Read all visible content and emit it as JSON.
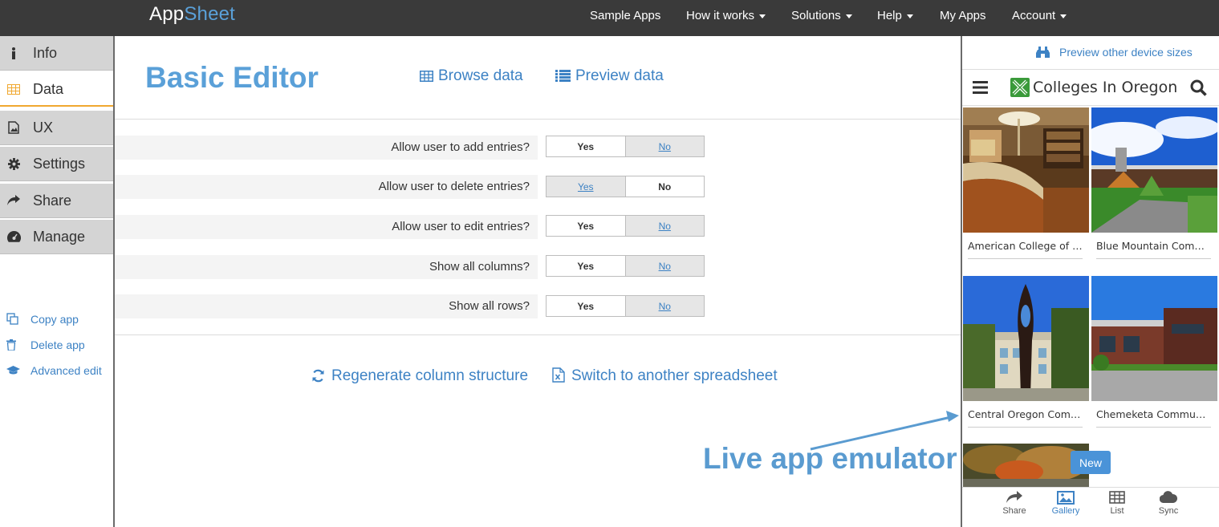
{
  "nav": {
    "brand_a": "App",
    "brand_b": "Sheet",
    "items": [
      "Sample Apps",
      "How it works",
      "Solutions",
      "Help",
      "My Apps",
      "Account"
    ]
  },
  "sidebar": {
    "items": [
      {
        "label": "Info",
        "icon": "info-icon"
      },
      {
        "label": "Data",
        "icon": "table-icon"
      },
      {
        "label": "UX",
        "icon": "image-file-icon"
      },
      {
        "label": "Settings",
        "icon": "gear-icon"
      },
      {
        "label": "Share",
        "icon": "share-arrow-icon"
      },
      {
        "label": "Manage",
        "icon": "dashboard-icon"
      }
    ],
    "links": [
      {
        "label": "Copy app",
        "icon": "copy-icon"
      },
      {
        "label": "Delete app",
        "icon": "trash-icon"
      },
      {
        "label": "Advanced edit",
        "icon": "graduation-cap-icon"
      }
    ]
  },
  "main": {
    "title": "Basic Editor",
    "browse_label": "Browse data",
    "preview_label": "Preview data",
    "options": [
      {
        "question": "Allow user to add entries?",
        "yes": "Yes",
        "no": "No",
        "selected": "no"
      },
      {
        "question": "Allow user to delete entries?",
        "yes": "Yes",
        "no": "No",
        "selected": "yes"
      },
      {
        "question": "Allow user to edit entries?",
        "yes": "Yes",
        "no": "No",
        "selected": "no"
      },
      {
        "question": "Show all columns?",
        "yes": "Yes",
        "no": "No",
        "selected": "no"
      },
      {
        "question": "Show all rows?",
        "yes": "Yes",
        "no": "No",
        "selected": "no"
      }
    ],
    "regenerate_label": "Regenerate column structure",
    "switch_label": "Switch to another spreadsheet",
    "annotation": "Live app emulator"
  },
  "emulator": {
    "preview_sizes": "Preview other device sizes",
    "app_title": "Colleges In Oregon",
    "tiles": [
      "American College of Healthcare Sciences",
      "Blue Mountain Community College",
      "Central Oregon Community College",
      "Chemeketa Community College"
    ],
    "new_label": "New",
    "tabs": [
      {
        "label": "Share",
        "active": false
      },
      {
        "label": "Gallery",
        "active": true
      },
      {
        "label": "List",
        "active": false
      },
      {
        "label": "Sync",
        "active": false
      }
    ],
    "colors": {
      "accent": "#3d82c4",
      "title": "#5aa0d8",
      "navbar": "#3a3a3a",
      "active_marker": "#f0a830"
    }
  }
}
